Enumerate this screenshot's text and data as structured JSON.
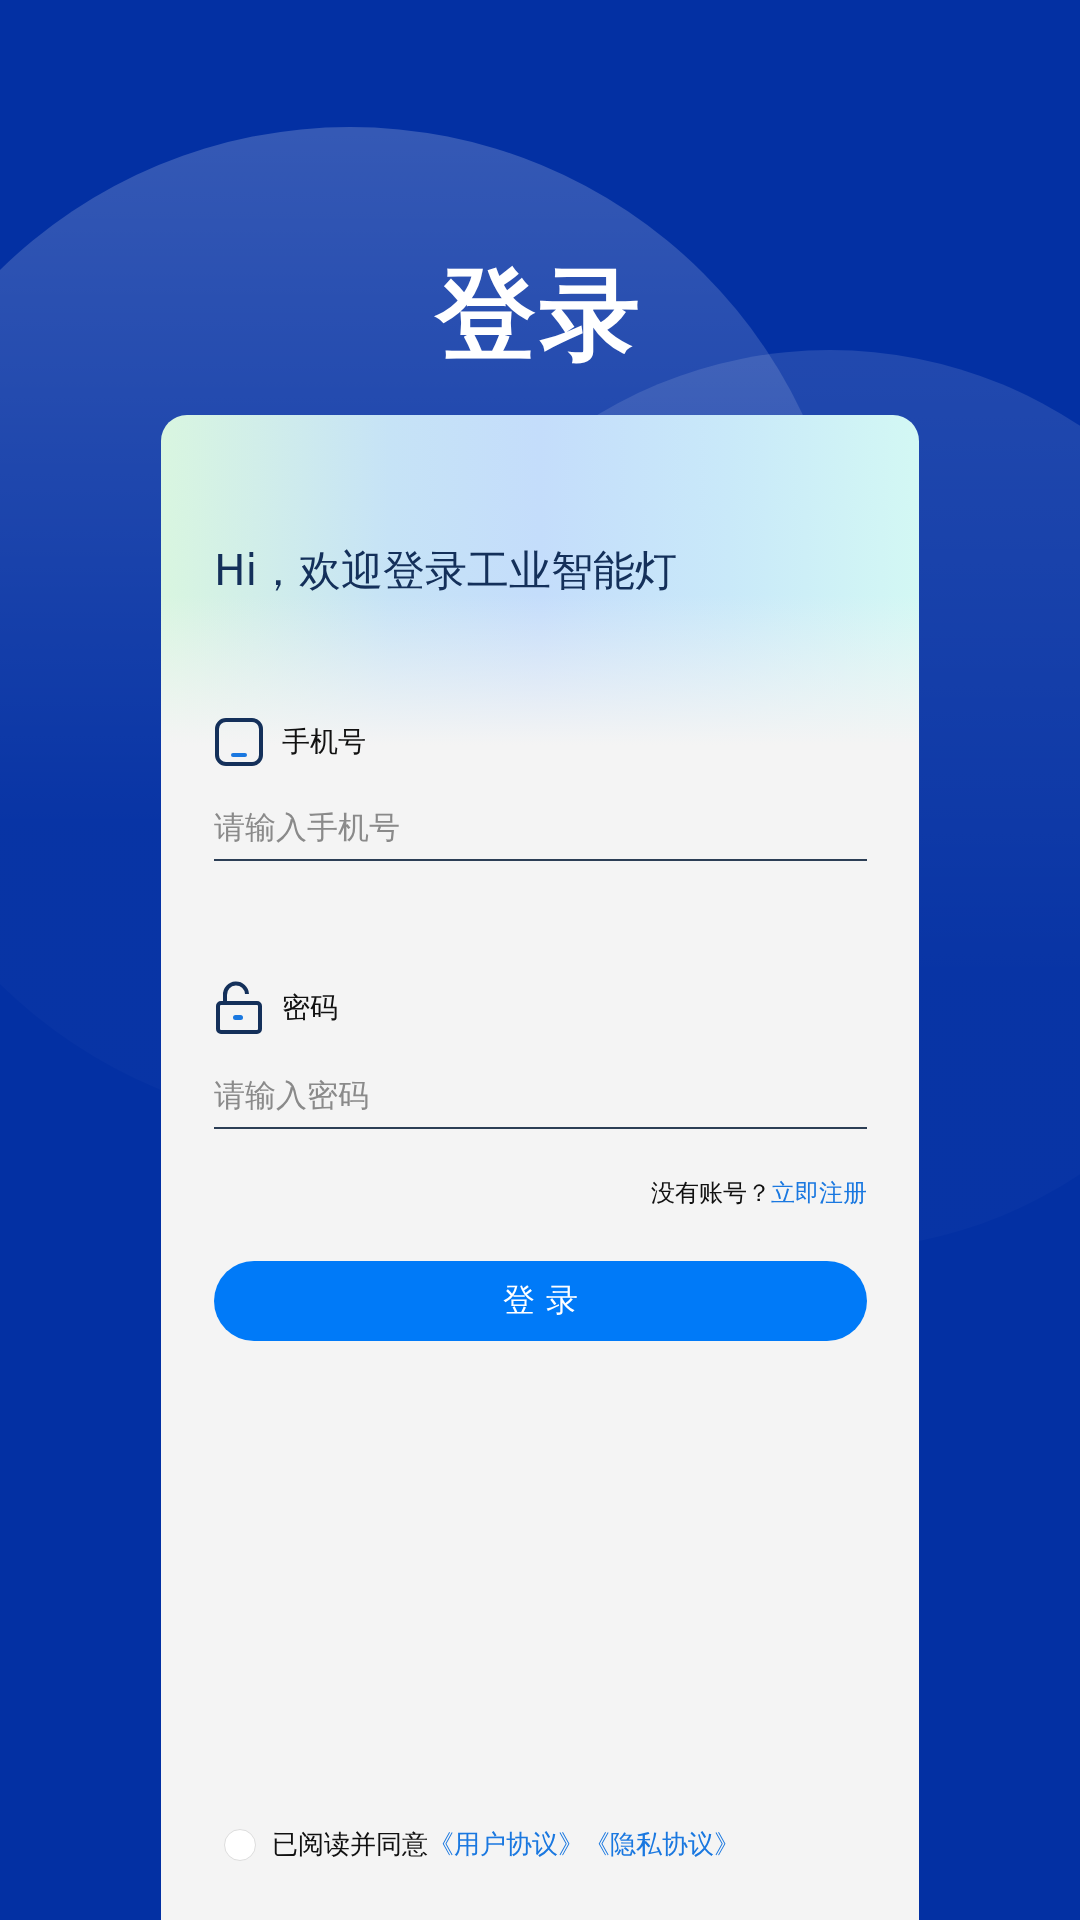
{
  "title": "登录",
  "card": {
    "greeting": "Hi，欢迎登录工业智能灯",
    "fields": [
      {
        "kind": "phone",
        "label": "手机号",
        "placeholder": "请输入手机号"
      },
      {
        "kind": "password",
        "label": "密码",
        "placeholder": "请输入密码"
      }
    ],
    "register_prompt": "没有账号？",
    "register_link": "立即注册",
    "login_button": "登 录",
    "agreement": {
      "checked": false,
      "text": "已阅读并同意",
      "links": [
        "《用户协议》",
        "《隐私协议》"
      ]
    }
  }
}
